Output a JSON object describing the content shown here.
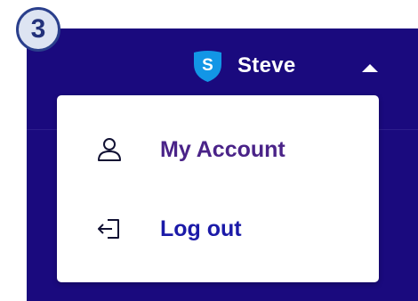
{
  "step_badge": {
    "number": "3"
  },
  "topbar": {
    "user_initial": "S",
    "user_name": "Steve"
  },
  "user_menu": {
    "items": [
      {
        "label": "My Account",
        "icon": "user-icon"
      },
      {
        "label": "Log out",
        "icon": "logout-icon"
      }
    ]
  },
  "colors": {
    "header_background": "#1a0a7e",
    "shield_blue": "#1296e6",
    "account_label": "#4a2388",
    "logout_label": "#1b1aa8",
    "badge_fill": "#dde4f2",
    "badge_border": "#2a3f8c"
  }
}
